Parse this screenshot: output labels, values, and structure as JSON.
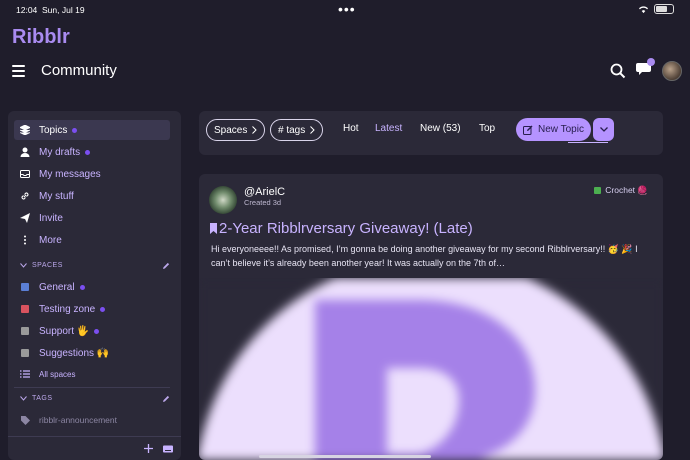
{
  "status": {
    "time": "12:04",
    "date": "Sun, Jul 19",
    "battery": "50"
  },
  "app": {
    "logo": "Ribblr",
    "page_title": "Community"
  },
  "sidebar": {
    "items": [
      {
        "label": "Topics",
        "icon": "layers-icon"
      },
      {
        "label": "My drafts",
        "icon": "person-icon"
      },
      {
        "label": "My messages",
        "icon": "inbox-icon"
      },
      {
        "label": "My stuff",
        "icon": "link-icon"
      },
      {
        "label": "Invite",
        "icon": "send-icon"
      },
      {
        "label": "More",
        "icon": "more-vertical-icon"
      }
    ],
    "spaces_heading": "SPACES",
    "spaces": [
      {
        "label": "General",
        "color": "#5b7fd6"
      },
      {
        "label": "Testing zone",
        "color": "#d9535f"
      },
      {
        "label": "Support 🖐",
        "color": "#9a9a9a"
      },
      {
        "label": "Suggestions 🙌",
        "color": "#9a9a9a"
      }
    ],
    "all_spaces": "All spaces",
    "tags_heading": "TAGS",
    "tags": [
      "ribblr-announcement"
    ]
  },
  "filters": {
    "spaces_pill": "Spaces",
    "tags_pill": "# tags",
    "tabs": [
      "Hot",
      "Latest",
      "New (53)",
      "Top"
    ],
    "active_tab": "Latest",
    "new_topic": "New Topic"
  },
  "post": {
    "username": "@ArielC",
    "created": "Created 3d",
    "category": "Crochet 🧶",
    "title": "2-Year Ribblrversary Giveaway! (Late)",
    "excerpt": "Hi everyoneeee!! As promised, I’m gonna be doing another giveaway for my second Ribblrversary!! 🥳 🎉 I can’t believe it’s already been another year! It was actually on the 7th of…"
  },
  "colors": {
    "accent": "#b593ff",
    "background": "#1f1d2b",
    "panel": "#2b2938"
  }
}
